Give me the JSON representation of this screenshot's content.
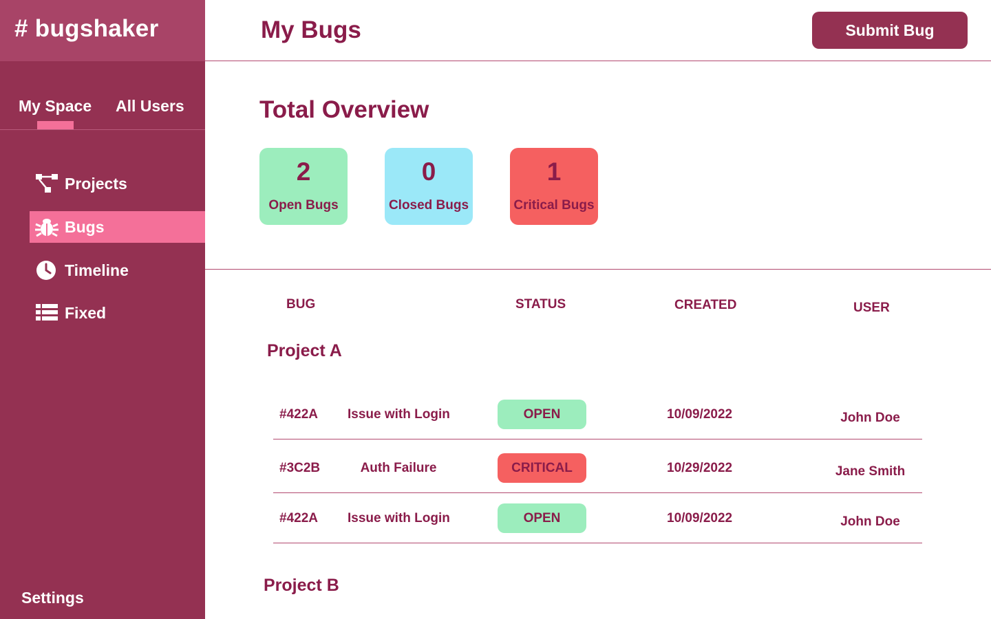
{
  "brand": {
    "text": "# bugshaker"
  },
  "space_tabs": [
    {
      "label": "My Space",
      "active": true
    },
    {
      "label": "All Users",
      "active": false
    }
  ],
  "nav": [
    {
      "label": "Projects",
      "icon": "hierarchy-icon",
      "active": false
    },
    {
      "label": "Bugs",
      "icon": "bug-icon",
      "active": true
    },
    {
      "label": "Timeline",
      "icon": "clock-icon",
      "active": false
    },
    {
      "label": "Fixed",
      "icon": "list-icon",
      "active": false
    }
  ],
  "settings": {
    "label": "Settings"
  },
  "header": {
    "title": "My Bugs",
    "submit_label": "Submit Bug"
  },
  "overview": {
    "title": "Total Overview",
    "cards": [
      {
        "value": "2",
        "label": "Open Bugs",
        "color": "#9cedbd"
      },
      {
        "value": "0",
        "label": "Closed Bugs",
        "color": "#9be8f8"
      },
      {
        "value": "1",
        "label": "Critical Bugs",
        "color": "#f56060"
      }
    ]
  },
  "table": {
    "headers": {
      "bug": "BUG",
      "status": "STATUS",
      "created": "CREATED",
      "user": "USER"
    },
    "projects": [
      {
        "name": "Project A",
        "rows": [
          {
            "id": "#422A",
            "title": "Issue with Login",
            "status": "OPEN",
            "created": "10/09/2022",
            "user": "John Doe"
          },
          {
            "id": "#3C2B",
            "title": "Auth Failure",
            "status": "CRITICAL",
            "created": "10/29/2022",
            "user": "Jane Smith"
          },
          {
            "id": "#422A",
            "title": "Issue with Login",
            "status": "OPEN",
            "created": "10/09/2022",
            "user": "John Doe"
          }
        ]
      },
      {
        "name": "Project B",
        "rows": []
      }
    ]
  },
  "colors": {
    "sidebar": "#943152",
    "brand_bg": "#a84467",
    "accent_pink": "#f47099",
    "text": "#8a1c4a",
    "status_open": "#9cedbd",
    "status_closed": "#9be8f8",
    "status_critical": "#f56060"
  }
}
